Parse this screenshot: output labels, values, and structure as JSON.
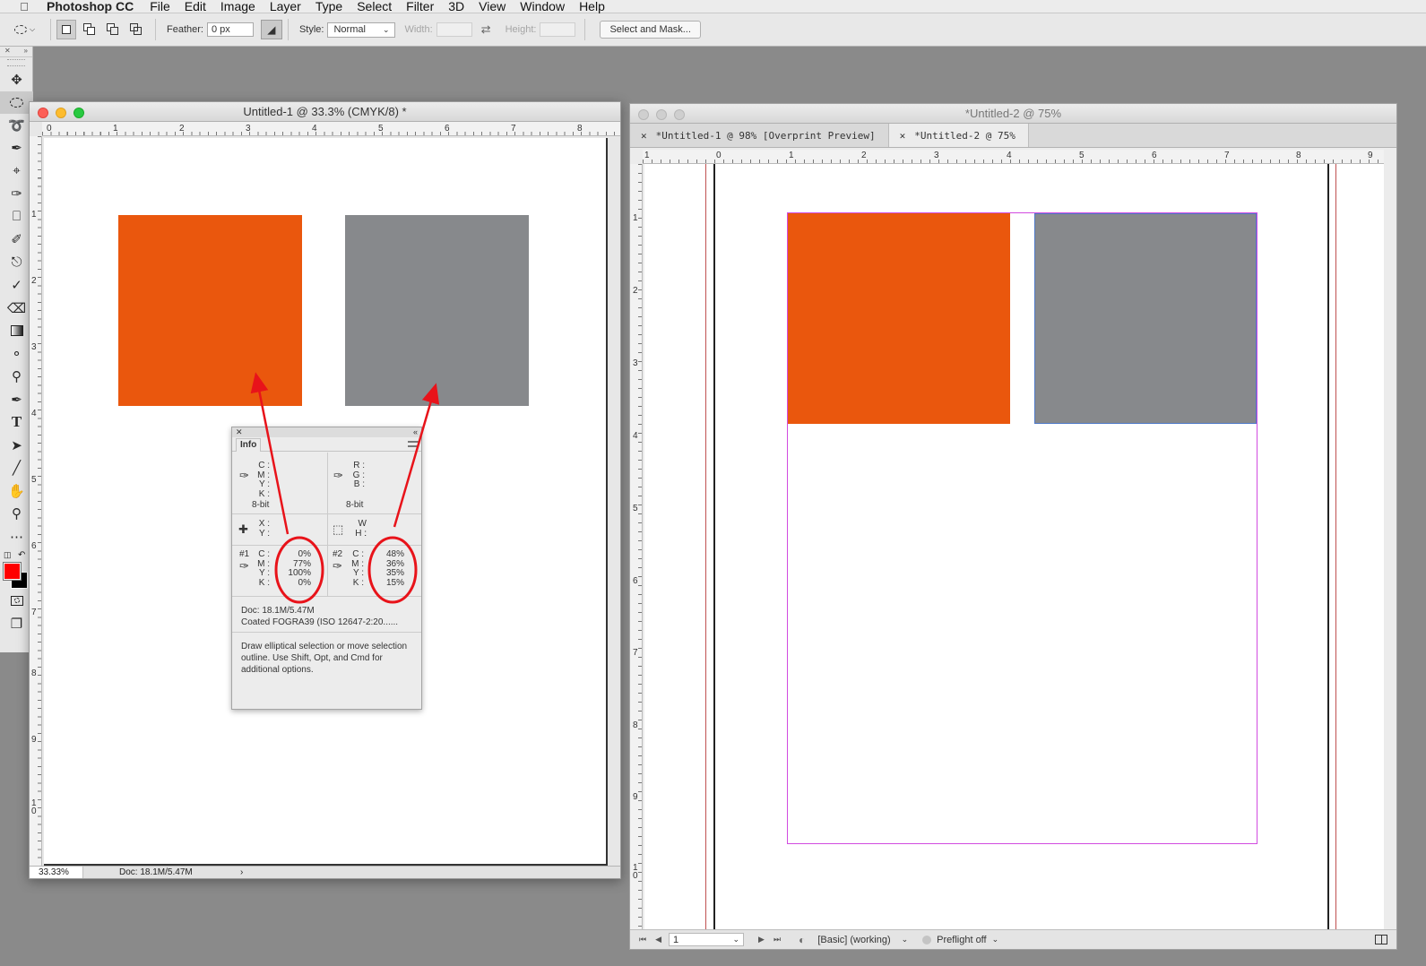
{
  "menubar": {
    "app": "Photoshop CC",
    "items": [
      "File",
      "Edit",
      "Image",
      "Layer",
      "Type",
      "Select",
      "Filter",
      "3D",
      "View",
      "Window",
      "Help"
    ]
  },
  "options": {
    "feather_label": "Feather:",
    "feather_value": "0 px",
    "style_label": "Style:",
    "style_value": "Normal",
    "width_label": "Width:",
    "height_label": "Height:",
    "select_mask": "Select and Mask..."
  },
  "doc1": {
    "title": "Untitled-1 @ 33.3% (CMYK/8) *",
    "ruler_h": [
      "0",
      "1",
      "2",
      "3",
      "4",
      "5",
      "6",
      "7",
      "8"
    ],
    "ruler_v": [
      "1",
      "2",
      "3",
      "4",
      "5",
      "6",
      "7",
      "8",
      "9",
      "1\n0"
    ],
    "zoom": "33.33%",
    "doc_size": "Doc: 18.1M/5.47M"
  },
  "info": {
    "tab": "Info",
    "cmyk_labels": [
      "C :",
      "M :",
      "Y :",
      "K :"
    ],
    "rgb_labels": [
      "R :",
      "G :",
      "B :"
    ],
    "bitdepth1": "8-bit",
    "bitdepth2": "8-bit",
    "xy_labels": [
      "X :",
      "Y :"
    ],
    "wh_labels": [
      "W :",
      "H :"
    ],
    "sample1_label": "#1",
    "sample1_values": [
      "0%",
      "77%",
      "100%",
      "0%"
    ],
    "sample2_label": "#2",
    "sample2_values": [
      "48%",
      "36%",
      "35%",
      "15%"
    ],
    "doc": "Doc: 18.1M/5.47M",
    "profile": "Coated FOGRA39 (ISO 12647-2:20......",
    "help": "Draw elliptical selection or move selection outline.  Use Shift, Opt, and Cmd for additional options."
  },
  "doc2": {
    "title": "*Untitled-2 @ 75%",
    "tabs": [
      "*Untitled-1 @ 98% [Overprint Preview]",
      "*Untitled-2 @ 75%"
    ],
    "ruler_h": [
      "1",
      "0",
      "1",
      "2",
      "3",
      "4",
      "5",
      "6",
      "7",
      "8",
      "9"
    ],
    "ruler_v": [
      "1",
      "2",
      "3",
      "4",
      "5",
      "6",
      "7",
      "8",
      "9",
      "1\n0"
    ],
    "page": "1",
    "style": "[Basic] (working)",
    "preflight": "Preflight off"
  },
  "colors": {
    "orange": "#ea570d",
    "gray": "#87898c",
    "annotation_red": "#e8131a",
    "margin_magenta": "#d14be0",
    "bleed_red": "#c05050"
  }
}
